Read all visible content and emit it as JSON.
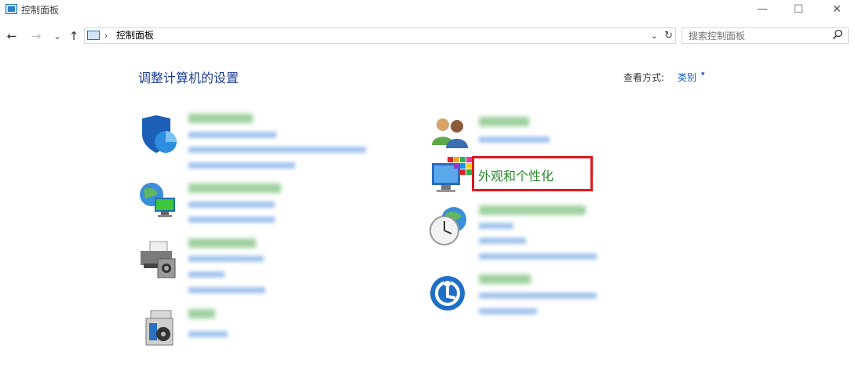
{
  "window": {
    "title": "控制面板",
    "minimize_symbol": "—",
    "maximize_symbol": "☐",
    "close_symbol": "✕"
  },
  "address_bar": {
    "back_symbol": "←",
    "forward_symbol": "→",
    "recent_symbol": "⌄",
    "up_symbol": "↑",
    "separator": "›",
    "path": "控制面板",
    "dropdown_symbol": "⌄",
    "refresh_symbol": "↻"
  },
  "search": {
    "placeholder": "搜索控制面板",
    "icon": "search-icon"
  },
  "header": {
    "title": "调整计算机的设置",
    "view_by_label": "查看方式:",
    "view_by_value": "类别",
    "view_by_caret": "▾"
  },
  "categories": {
    "appearance": {
      "title": "外观和个性化"
    }
  },
  "colors": {
    "accent": "#1c3f95",
    "link": "#1a5fc2",
    "category_title": "#2a8a2a",
    "highlight": "#e0191b"
  }
}
